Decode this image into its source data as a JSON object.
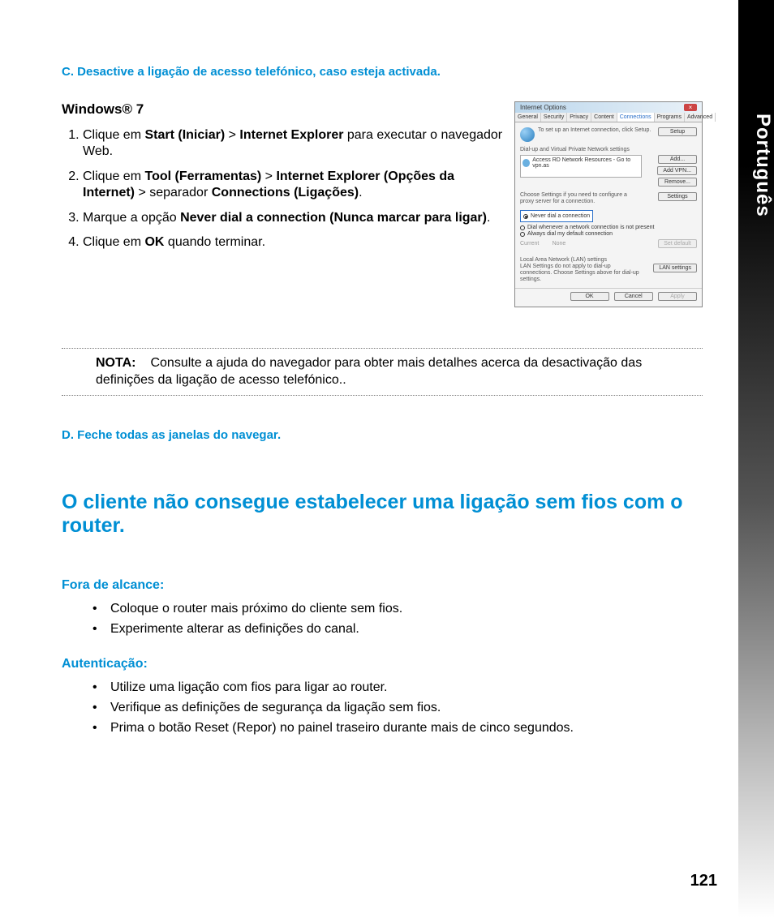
{
  "sideTab": {
    "label": "Português"
  },
  "sectionC": {
    "heading": "C.   Desactive a ligação de acesso telefónico, caso esteja activada."
  },
  "win7": {
    "heading": "Windows® 7"
  },
  "steps": {
    "s1_a": "Clique em ",
    "s1_b": "Start (Iniciar)",
    "s1_c": " > ",
    "s1_d": "Internet Explorer",
    "s1_e": " para executar o navegador Web.",
    "s2_a": "Clique em ",
    "s2_b": "Tool (Ferramentas)",
    "s2_c": " > ",
    "s2_d": "Internet Explorer (Opções da Internet)",
    "s2_e": " > separador ",
    "s2_f": "Connections (Ligações)",
    "s2_g": ".",
    "s3_a": "Marque a opção ",
    "s3_b": "Never dial a connection (Nunca marcar para ligar)",
    "s3_c": ".",
    "s4_a": "Clique em ",
    "s4_b": "OK",
    "s4_c": " quando terminar."
  },
  "dialog": {
    "title": "Internet Options",
    "tabs": {
      "general": "General",
      "security": "Security",
      "privacy": "Privacy",
      "content": "Content",
      "connections": "Connections",
      "programs": "Programs",
      "advanced": "Advanced"
    },
    "setupText": "To set up an Internet connection, click Setup.",
    "setupBtn": "Setup",
    "dialHeader": "Dial-up and Virtual Private Network settings",
    "listItem": "Access RD Network Resources - Go to vpn.as",
    "addBtn": "Add...",
    "addVpnBtn": "Add VPN...",
    "removeBtn": "Remove...",
    "chooseText": "Choose Settings if you need to configure a proxy server for a connection.",
    "settingsBtn": "Settings",
    "r1": "Never dial a connection",
    "r2": "Dial whenever a network connection is not present",
    "r3": "Always dial my default connection",
    "currentLabel": "Current",
    "currentVal": "None",
    "setDefaultBtn": "Set default",
    "lanHeader": "Local Area Network (LAN) settings",
    "lanText": "LAN Settings do not apply to dial-up connections. Choose Settings above for dial-up settings.",
    "lanBtn": "LAN settings",
    "okBtn": "OK",
    "cancelBtn": "Cancel",
    "applyBtn": "Apply"
  },
  "nota": {
    "label": "NOTA:",
    "text": "Consulte a ajuda do navegador para obter mais detalhes acerca da desactivação das definições da ligação de acesso telefónico.."
  },
  "sectionD": {
    "heading": "D.   Feche todas as janelas do navegar."
  },
  "bigHeading": "O cliente não consegue estabelecer uma ligação sem fios com o router.",
  "fora": {
    "heading": "Fora de alcance:",
    "b1": "Coloque o router mais próximo do cliente sem fios.",
    "b2": "Experimente alterar as definições do canal."
  },
  "aut": {
    "heading": "Autenticação:",
    "b1": "Utilize uma ligação com fios para ligar ao router.",
    "b2": "Verifique as definições de segurança da ligação sem fios.",
    "b3": "Prima o botão Reset (Repor) no painel traseiro durante mais de cinco segundos."
  },
  "pageNumber": "121"
}
